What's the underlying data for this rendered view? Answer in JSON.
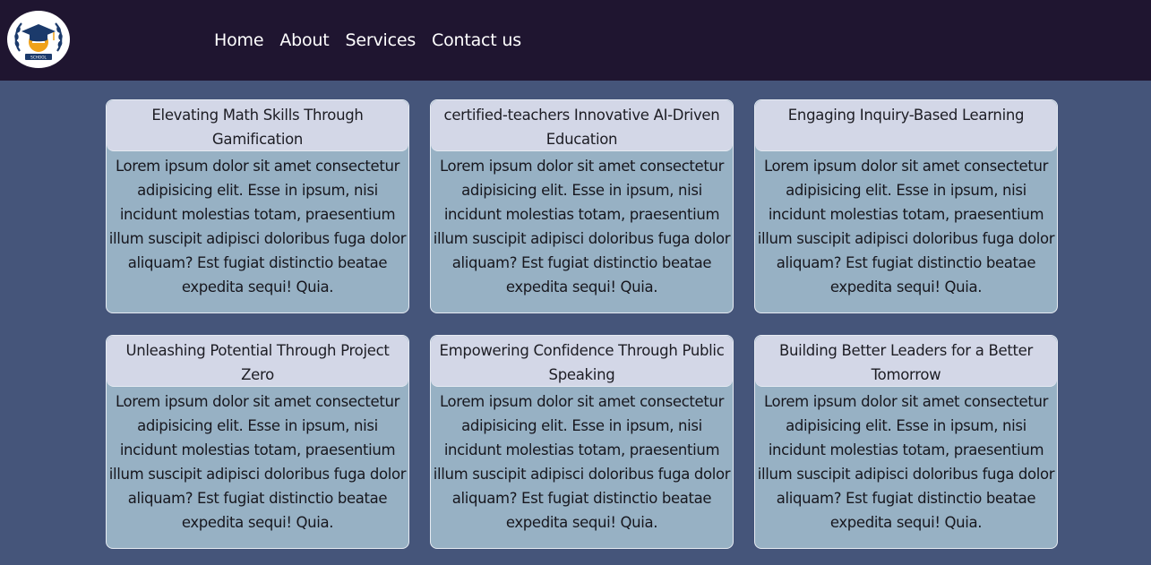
{
  "nav": {
    "logo_text": "SCHOOL",
    "links": [
      "Home",
      "About",
      "Services",
      "Contact us"
    ]
  },
  "cards": [
    {
      "title": "Elevating Math Skills Through Gamification",
      "body": "Lorem ipsum dolor sit amet consectetur adipisicing elit. Esse in ipsum, nisi incidunt molestias totam, praesentium illum suscipit adipisci doloribus fuga dolor aliquam? Est fugiat distinctio beatae expedita sequi! Quia."
    },
    {
      "title": "certified-teachers Innovative AI-Driven Education",
      "body": "Lorem ipsum dolor sit amet consectetur adipisicing elit. Esse in ipsum, nisi incidunt molestias totam, praesentium illum suscipit adipisci doloribus fuga dolor aliquam? Est fugiat distinctio beatae expedita sequi! Quia."
    },
    {
      "title": "Engaging Inquiry-Based Learning",
      "body": "Lorem ipsum dolor sit amet consectetur adipisicing elit. Esse in ipsum, nisi incidunt molestias totam, praesentium illum suscipit adipisci doloribus fuga dolor aliquam? Est fugiat distinctio beatae expedita sequi! Quia."
    },
    {
      "title": "Unleashing Potential Through Project Zero",
      "body": "Lorem ipsum dolor sit amet consectetur adipisicing elit. Esse in ipsum, nisi incidunt molestias totam, praesentium illum suscipit adipisci doloribus fuga dolor aliquam? Est fugiat distinctio beatae expedita sequi! Quia."
    },
    {
      "title": "Empowering Confidence Through Public Speaking",
      "body": "Lorem ipsum dolor sit amet consectetur adipisicing elit. Esse in ipsum, nisi incidunt molestias totam, praesentium illum suscipit adipisci doloribus fuga dolor aliquam? Est fugiat distinctio beatae expedita sequi! Quia."
    },
    {
      "title": "Building Better Leaders for a Better Tomorrow",
      "body": "Lorem ipsum dolor sit amet consectetur adipisicing elit. Esse in ipsum, nisi incidunt molestias totam, praesentium illum suscipit adipisci doloribus fuga dolor aliquam? Est fugiat distinctio beatae expedita sequi! Quia."
    }
  ],
  "colors": {
    "navbar": "#1f1530",
    "page_background": "#45557a",
    "card_body": "#97b1c4",
    "card_header": "#d3d7e7",
    "logo_accent_blue": "#1b3a6b",
    "logo_accent_gold": "#f0a21a"
  }
}
